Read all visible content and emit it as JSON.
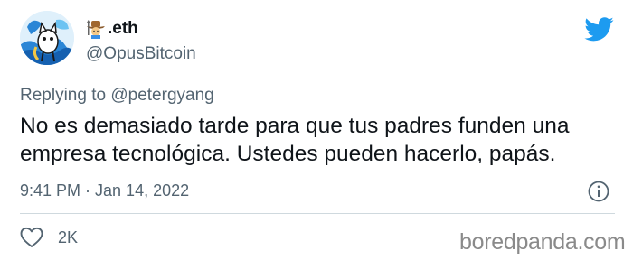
{
  "tweet": {
    "display_name": ".eth",
    "handle": "@OpusBitcoin",
    "replying_prefix": "Replying to",
    "replying_to": "@petergyang",
    "text": "No es demasiado tarde para que tus padres funden una empresa tecnológica. Ustedes pueden hacerlo, papás.",
    "timestamp": "9:41 PM · Jan 14, 2022",
    "like_count": "2K"
  },
  "watermark": {
    "text": "boredpanda.com"
  },
  "icons": {
    "platform": "twitter-bird-icon",
    "info": "info-icon",
    "like": "heart-icon",
    "name_emoji": "cowboy-emoji-icon"
  },
  "colors": {
    "brand_blue": "#1d9bf0",
    "text_primary": "#0f1419",
    "text_secondary": "#536471",
    "divider": "#cfd9de",
    "watermark": "#8a8a8a"
  }
}
